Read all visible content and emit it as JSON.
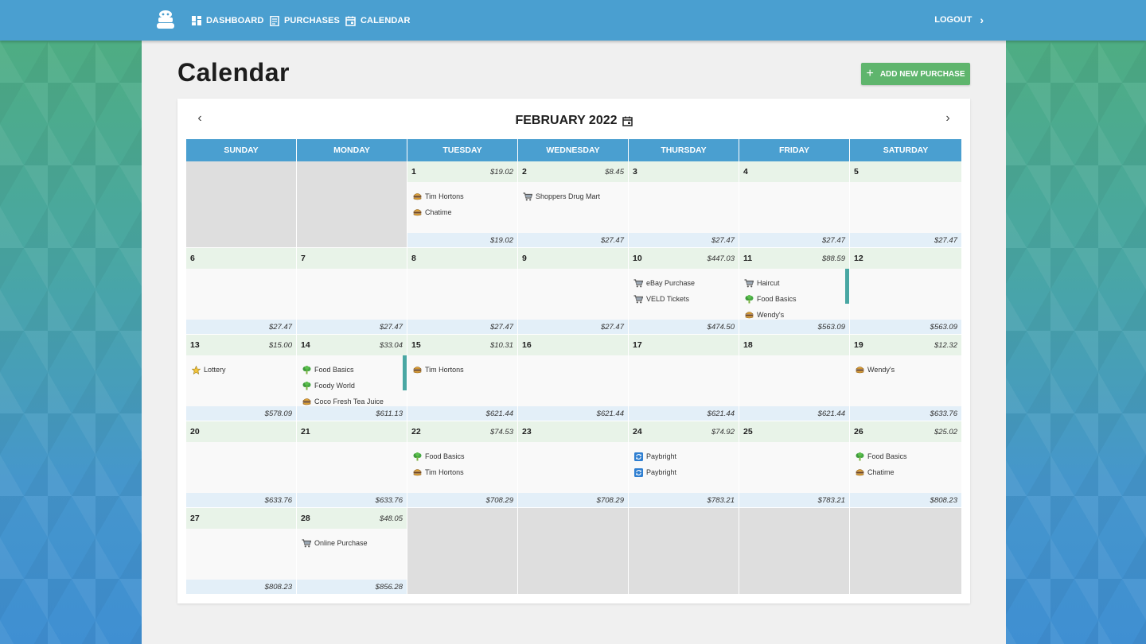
{
  "nav": {
    "dashboard": "DASHBOARD",
    "purchases": "PURCHASES",
    "calendar": "CALENDAR",
    "logout": "LOGOUT"
  },
  "page": {
    "title": "Calendar",
    "add_button": "ADD NEW PURCHASE"
  },
  "calendar": {
    "month": "FEBRUARY 2022",
    "days_of_week": [
      "SUNDAY",
      "MONDAY",
      "TUESDAY",
      "WEDNESDAY",
      "THURSDAY",
      "FRIDAY",
      "SATURDAY"
    ],
    "weeks": [
      [
        {
          "empty": true
        },
        {
          "empty": true
        },
        {
          "num": "1",
          "amount": "$19.02",
          "total": "$19.02",
          "items": [
            {
              "icon": "burger-icon",
              "label": "Tim Hortons"
            },
            {
              "icon": "burger-icon",
              "label": "Chatime"
            }
          ]
        },
        {
          "num": "2",
          "amount": "$8.45",
          "total": "$27.47",
          "items": [
            {
              "icon": "cart-icon",
              "label": "Shoppers Drug Mart"
            }
          ]
        },
        {
          "num": "3",
          "amount": "",
          "total": "$27.47",
          "items": []
        },
        {
          "num": "4",
          "amount": "",
          "total": "$27.47",
          "items": []
        },
        {
          "num": "5",
          "amount": "",
          "total": "$27.47",
          "items": []
        }
      ],
      [
        {
          "num": "6",
          "amount": "",
          "total": "$27.47",
          "items": []
        },
        {
          "num": "7",
          "amount": "",
          "total": "$27.47",
          "items": []
        },
        {
          "num": "8",
          "amount": "",
          "total": "$27.47",
          "items": []
        },
        {
          "num": "9",
          "amount": "",
          "total": "$27.47",
          "items": []
        },
        {
          "num": "10",
          "amount": "$447.03",
          "total": "$474.50",
          "items": [
            {
              "icon": "cart-icon",
              "label": "eBay Purchase"
            },
            {
              "icon": "cart-icon",
              "label": "VELD Tickets"
            }
          ]
        },
        {
          "num": "11",
          "amount": "$88.59",
          "total": "$563.09",
          "scroll": true,
          "items": [
            {
              "icon": "cart-icon",
              "label": "Haircut"
            },
            {
              "icon": "broccoli-icon",
              "label": "Food Basics"
            },
            {
              "icon": "burger-icon",
              "label": "Wendy's"
            }
          ]
        },
        {
          "num": "12",
          "amount": "",
          "total": "$563.09",
          "items": []
        }
      ],
      [
        {
          "num": "13",
          "amount": "$15.00",
          "total": "$578.09",
          "items": [
            {
              "icon": "star-icon",
              "label": "Lottery"
            }
          ]
        },
        {
          "num": "14",
          "amount": "$33.04",
          "total": "$611.13",
          "scroll": true,
          "items": [
            {
              "icon": "broccoli-icon",
              "label": "Food Basics"
            },
            {
              "icon": "broccoli-icon",
              "label": "Foody World"
            },
            {
              "icon": "burger-icon",
              "label": "Coco Fresh Tea Juice"
            }
          ]
        },
        {
          "num": "15",
          "amount": "$10.31",
          "total": "$621.44",
          "items": [
            {
              "icon": "burger-icon",
              "label": "Tim Hortons"
            }
          ]
        },
        {
          "num": "16",
          "amount": "",
          "total": "$621.44",
          "items": []
        },
        {
          "num": "17",
          "amount": "",
          "total": "$621.44",
          "items": []
        },
        {
          "num": "18",
          "amount": "",
          "total": "$621.44",
          "items": []
        },
        {
          "num": "19",
          "amount": "$12.32",
          "total": "$633.76",
          "items": [
            {
              "icon": "burger-icon",
              "label": "Wendy's"
            }
          ]
        }
      ],
      [
        {
          "num": "20",
          "amount": "",
          "total": "$633.76",
          "items": []
        },
        {
          "num": "21",
          "amount": "",
          "total": "$633.76",
          "items": []
        },
        {
          "num": "22",
          "amount": "$74.53",
          "total": "$708.29",
          "items": [
            {
              "icon": "broccoli-icon",
              "label": "Food Basics"
            },
            {
              "icon": "burger-icon",
              "label": "Tim Hortons"
            }
          ]
        },
        {
          "num": "23",
          "amount": "",
          "total": "$708.29",
          "items": []
        },
        {
          "num": "24",
          "amount": "$74.92",
          "total": "$783.21",
          "items": [
            {
              "icon": "refresh-icon",
              "label": "Paybright"
            },
            {
              "icon": "refresh-icon",
              "label": "Paybright"
            }
          ]
        },
        {
          "num": "25",
          "amount": "",
          "total": "$783.21",
          "items": []
        },
        {
          "num": "26",
          "amount": "$25.02",
          "total": "$808.23",
          "items": [
            {
              "icon": "broccoli-icon",
              "label": "Food Basics"
            },
            {
              "icon": "burger-icon",
              "label": "Chatime"
            }
          ]
        }
      ],
      [
        {
          "num": "27",
          "amount": "",
          "total": "$808.23",
          "items": []
        },
        {
          "num": "28",
          "amount": "$48.05",
          "total": "$856.28",
          "items": [
            {
              "icon": "cart-icon",
              "label": "Online Purchase"
            }
          ]
        },
        {
          "empty": true
        },
        {
          "empty": true
        },
        {
          "empty": true
        },
        {
          "empty": true
        },
        {
          "empty": true
        }
      ]
    ]
  },
  "colors": {
    "topbar": "#4a9fd0",
    "header_cell": "#4a9fd0",
    "day_top": "#e8f3e8",
    "day_foot": "#e3eff8",
    "add_button": "#5fb56d",
    "empty_cell": "#dedede"
  }
}
